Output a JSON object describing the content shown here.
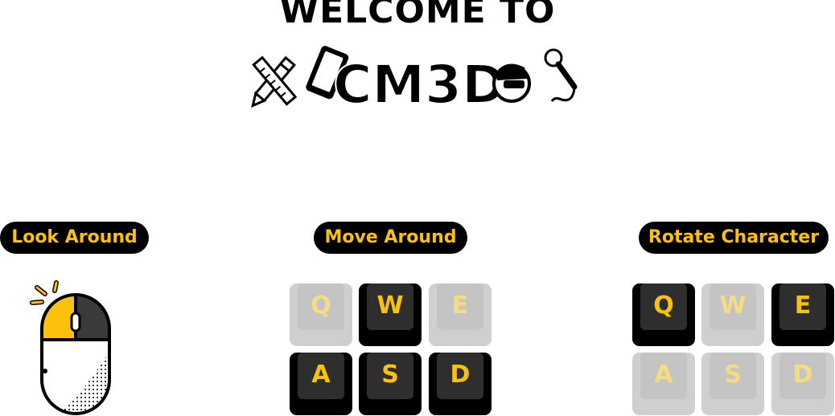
{
  "header": {
    "welcome": "WELCOME TO",
    "logo_text": "CM3D"
  },
  "colors": {
    "accent": "#fcc10b",
    "pill_bg": "#000000",
    "key_active": "#000000",
    "key_active_cap": "#2e2e2e",
    "key_inactive": "#cfcfcf",
    "key_inactive_cap": "#c4c4c4"
  },
  "controls": {
    "look": {
      "label": "Look Around",
      "icon": "mouse-icon"
    },
    "move": {
      "label": "Move Around",
      "keys": [
        {
          "key": "Q",
          "active": false
        },
        {
          "key": "W",
          "active": true
        },
        {
          "key": "E",
          "active": false
        },
        {
          "key": "A",
          "active": true
        },
        {
          "key": "S",
          "active": true
        },
        {
          "key": "D",
          "active": true
        }
      ]
    },
    "rotate": {
      "label": "Rotate Character",
      "keys": [
        {
          "key": "Q",
          "active": true
        },
        {
          "key": "W",
          "active": false
        },
        {
          "key": "E",
          "active": true
        },
        {
          "key": "A",
          "active": false
        },
        {
          "key": "S",
          "active": false
        },
        {
          "key": "D",
          "active": false
        }
      ]
    }
  }
}
